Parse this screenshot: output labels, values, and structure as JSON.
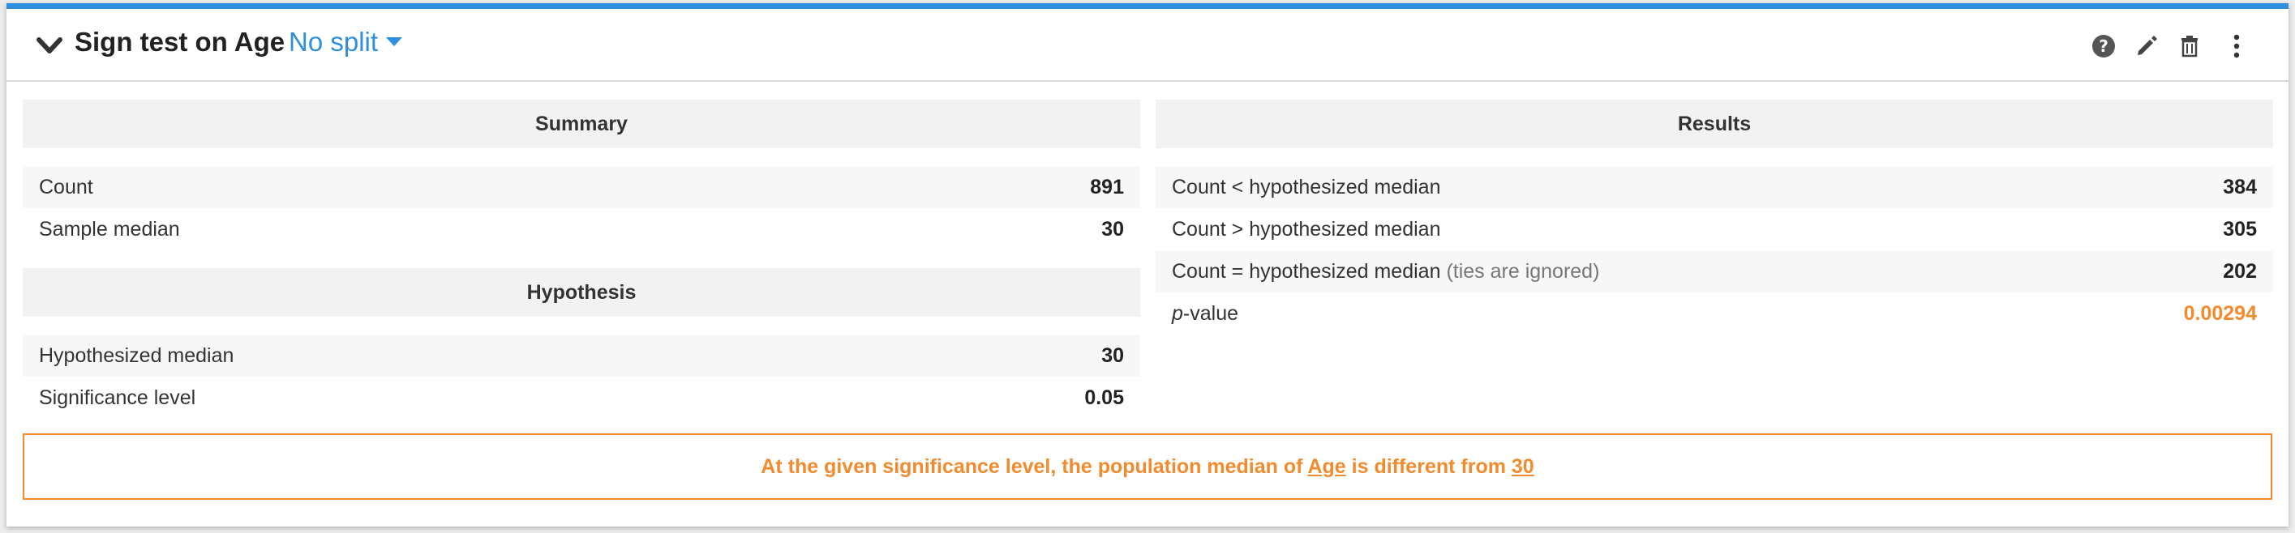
{
  "header": {
    "title": "Sign test on Age",
    "split_label": "No split",
    "icons": [
      "help-icon",
      "edit-icon",
      "trash-icon",
      "more-vertical-icon"
    ]
  },
  "summary": {
    "title": "Summary",
    "rows": [
      {
        "label": "Count",
        "value": "891"
      },
      {
        "label": "Sample median",
        "value": "30"
      }
    ]
  },
  "hypothesis": {
    "title": "Hypothesis",
    "rows": [
      {
        "label": "Hypothesized median",
        "value": "30"
      },
      {
        "label": "Significance level",
        "value": "0.05"
      }
    ]
  },
  "results": {
    "title": "Results",
    "rows": [
      {
        "label": "Count < hypothesized median",
        "value": "384"
      },
      {
        "label": "Count > hypothesized median",
        "value": "305"
      },
      {
        "label": "Count = hypothesized median",
        "note": "(ties are ignored)",
        "value": "202"
      }
    ],
    "pvalue": {
      "label_p": "p",
      "label_rest": "-value",
      "value": "0.00294"
    }
  },
  "conclusion": {
    "prefix": "At the given significance level, the population median of ",
    "variable": "Age",
    "middle": " is different from ",
    "median": "30"
  },
  "colors": {
    "accent": "#2f8fdd",
    "warning": "#f28a2e"
  }
}
